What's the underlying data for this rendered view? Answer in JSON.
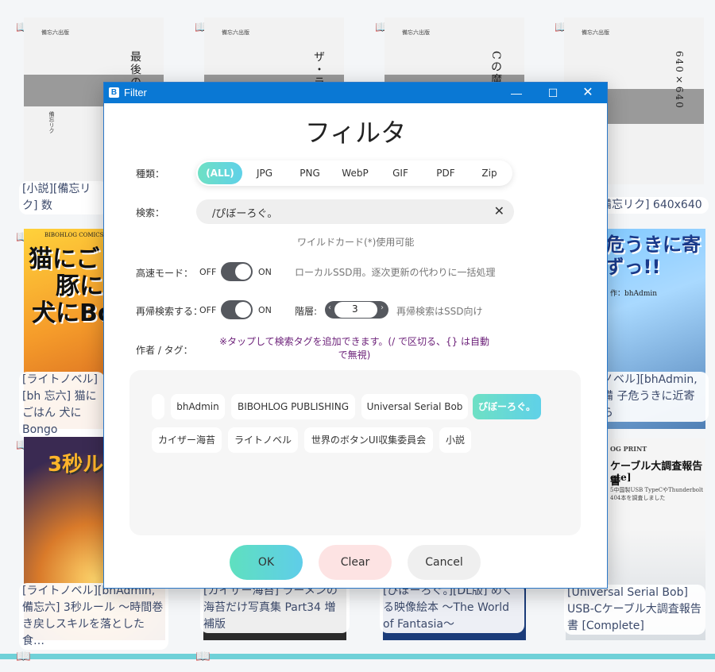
{
  "gallery": {
    "covers": [
      {
        "publisher": "備忘六出版",
        "title": "最後の",
        "author": "備忘リク"
      },
      {
        "publisher": "備忘六出版",
        "title": "ザ・ラ"
      },
      {
        "publisher": "備忘六出版",
        "title": "Cの魔"
      },
      {
        "publisher": "備忘六出版",
        "title": "640×640"
      }
    ],
    "comic_texts": {
      "bibohlog_comics": "BIBOHLOG COMICS",
      "cat_line1": "猫にご",
      "cat_line2": "豚に",
      "cat_line3": "犬にBo",
      "danger_title": "子危うきに寄らずっ!!",
      "danger_author": "作：bhAdmin",
      "toast_title": "3秒ル",
      "cable_header": "OG PRINT",
      "cable_title": "ケーブル大調査報告書",
      "cable_sub": "ete]",
      "cable_desc1": "5中国製USB TypeCやThunderbolt",
      "cable_desc2": "404本を調査しました"
    },
    "captions": {
      "c1": "[小説][備忘リク] 数",
      "c4": "備忘リク] 640x640",
      "c5": "[ライトノベル][bh 忘六] 猫にごはん 犬にBongo",
      "c8": "ノベル][bhAdmin, 備 子危うきに近寄ら",
      "c9": "[ライトノベル][bhAdmin, 備忘六] 3秒ルール ～時間巻き戻しスキルを落とした食…",
      "c10": "[カイザー海苔] ラーメンの海苔だけ写真集 Part34 増補版",
      "c11": "[ぴぼーろぐ。][DL版] めくる映像絵本 ～The World of Fantasia～",
      "c12": "[Universal Serial Bob] USB-Cケーブル大調査報告書 [Complete]"
    }
  },
  "window": {
    "title": "Filter",
    "app_icon": "B",
    "minimize_label": "—",
    "maximize_label": "☐",
    "close_label": "✕"
  },
  "dialog": {
    "heading": "フィルタ",
    "type_label": "種類：",
    "types": [
      "(ALL)",
      "JPG",
      "PNG",
      "WebP",
      "GIF",
      "PDF",
      "Zip"
    ],
    "selected_type": "(ALL)",
    "search_label": "検索：",
    "search_value": "/ぴぼーろぐ。",
    "search_clear": "✕",
    "wildcard_hint": "ワイルドカード(*)使用可能",
    "fast_mode_label": "高速モード：",
    "fast_mode_off": "OFF",
    "fast_mode_on": "ON",
    "fast_mode_state": true,
    "fast_mode_hint": "ローカルSSD用。逐次更新の代わりに一括処理",
    "recursive_label": "再帰検索する：",
    "recursive_off": "OFF",
    "recursive_on": "ON",
    "recursive_state": true,
    "depth_label": "階層:",
    "depth_value": "3",
    "depth_hint": "再帰検索はSSD向け",
    "tag_label": "作者 / タグ：",
    "tag_notice": "※タップして検索タグを追加できます。(/ で区切る、{} は自動で無視)",
    "tags_row1": [
      "",
      "bhAdmin",
      "BIBOHLOG PUBLISHING",
      "Universal Serial Bob",
      "ぴぼーろぐ。"
    ],
    "tags_row2": [
      "カイザー海苔",
      "ライトノベル",
      "世界のボタンUI収集委員会",
      "小説"
    ],
    "selected_tag": "ぴぼーろぐ。",
    "ok_label": "OK",
    "clear_label": "Clear",
    "cancel_label": "Cancel"
  },
  "colors": {
    "titlebar": "#0a78d4",
    "accent_gradient_start": "#6ee0c4",
    "accent_gradient_end": "#5fd1e8",
    "tag_notice": "#6b1f78",
    "toggle_track": "#55585e"
  }
}
